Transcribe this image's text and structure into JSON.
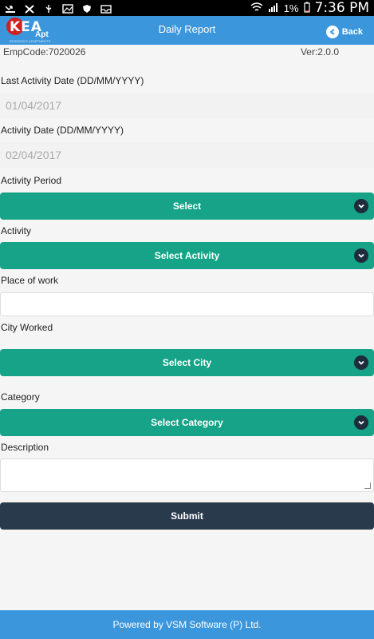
{
  "status": {
    "battery": "1%",
    "time": "7:36 PM"
  },
  "header": {
    "logo_text": "KEA",
    "logo_sub": "Apt",
    "logo_tagline": "RESIDENCY APARTMENTS",
    "title": "Daily Report",
    "back_label": "Back"
  },
  "meta": {
    "emp_code": "EmpCode:7020026",
    "version": "Ver:2.0.0"
  },
  "form": {
    "last_activity_label": "Last Activity Date (DD/MM/YYYY)",
    "last_activity_value": "01/04/2017",
    "activity_date_label": "Activity Date (DD/MM/YYYY)",
    "activity_date_value": "02/04/2017",
    "activity_period_label": "Activity Period",
    "activity_period_select": "Select",
    "activity_label": "Activity",
    "activity_select": "Select Activity",
    "place_label": "Place of work",
    "place_value": "",
    "city_label": "City Worked",
    "city_select": "Select City",
    "category_label": "Category",
    "category_select": "Select Category",
    "description_label": "Description",
    "description_value": "",
    "submit_label": "Submit"
  },
  "footer": {
    "text": "Powered by VSM Software (P) Ltd."
  },
  "colors": {
    "header": "#3b96dc",
    "select": "#17a387",
    "submit": "#2a3a4d"
  }
}
